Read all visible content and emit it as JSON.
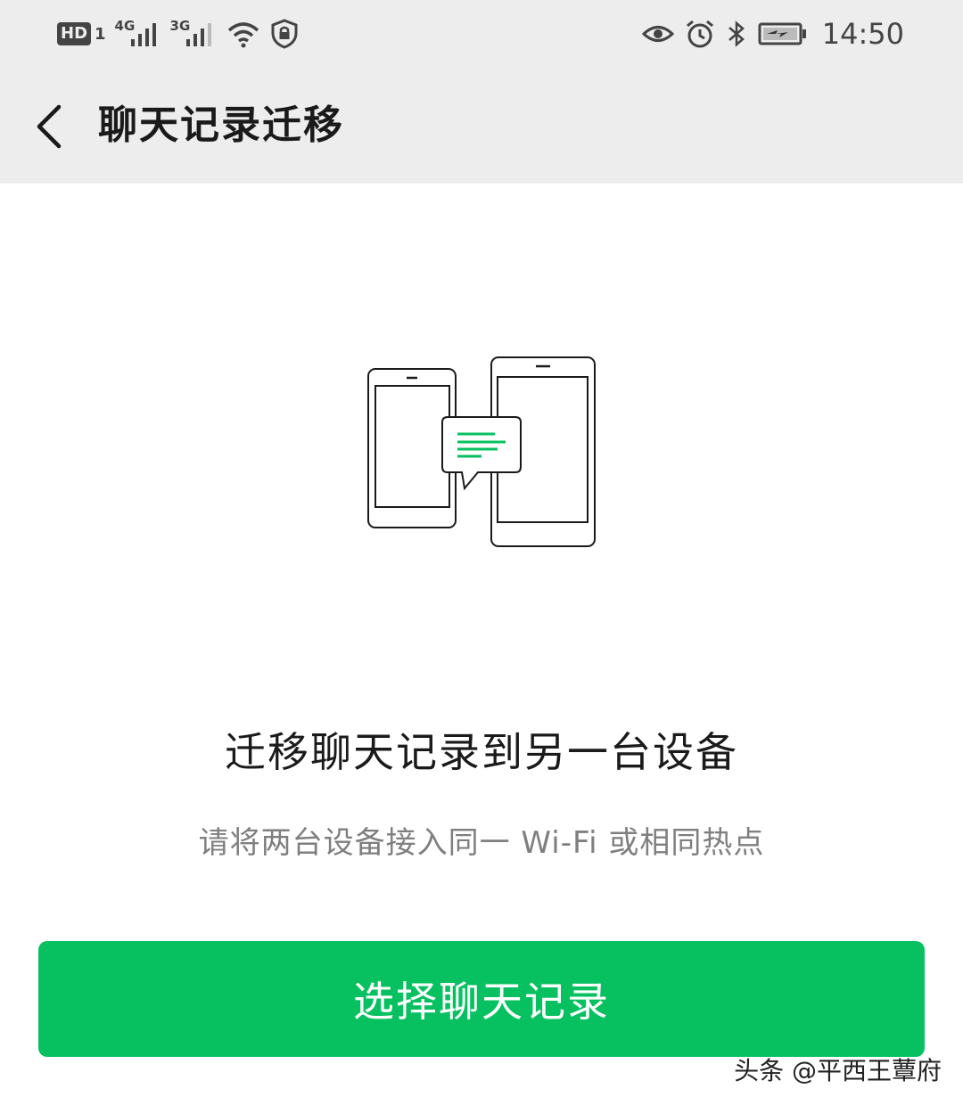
{
  "status_bar": {
    "hd_label": "HD",
    "sim_label": "1",
    "net1": "4G",
    "net2": "3G",
    "time": "14:50",
    "icons": [
      "hd-icon",
      "signal-icon",
      "signal-icon",
      "wifi-icon",
      "vpn-shield-icon",
      "eye-icon",
      "alarm-icon",
      "bluetooth-icon",
      "battery-charging-icon"
    ]
  },
  "nav": {
    "title": "聊天记录迁移",
    "back_icon": "chevron-left-icon"
  },
  "main": {
    "illustration_icons": [
      "phone-icon",
      "tablet-icon",
      "chat-bubble-icon"
    ],
    "headline": "迁移聊天记录到另一台设备",
    "subline": "请将两台设备接入同一 Wi-Fi 或相同热点",
    "primary_button": "选择聊天记录"
  },
  "watermark": "头条 @平西王蕈府",
  "colors": {
    "accent": "#07c160",
    "topbar_bg": "#ededed",
    "text_primary": "#1a1a1a",
    "text_secondary": "#7f7f7f",
    "button_text": "#ffffff"
  }
}
